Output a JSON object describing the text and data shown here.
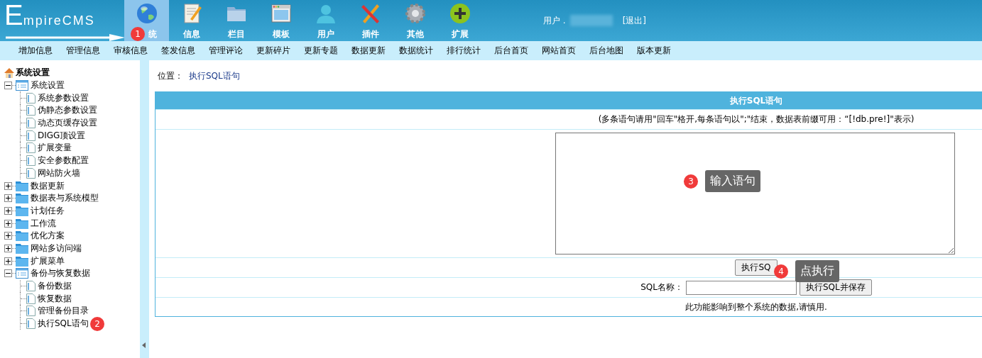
{
  "header": {
    "logo": {
      "initial": "E",
      "rest": "mpireCMS"
    },
    "nav": [
      {
        "label": "统",
        "kind": "globe",
        "selected": true
      },
      {
        "label": "信息",
        "kind": "note",
        "selected": false
      },
      {
        "label": "栏目",
        "kind": "folder",
        "selected": false
      },
      {
        "label": "模板",
        "kind": "window",
        "selected": false
      },
      {
        "label": "用户",
        "kind": "user",
        "selected": false
      },
      {
        "label": "插件",
        "kind": "tools",
        "selected": false
      },
      {
        "label": "其他",
        "kind": "gear",
        "selected": false
      },
      {
        "label": "扩展",
        "kind": "plus",
        "selected": false
      }
    ],
    "user_label": "用户 .",
    "logout": "[退出]"
  },
  "menu": [
    "增加信息",
    "管理信息",
    "审核信息",
    "签发信息",
    "管理评论",
    "更新碎片",
    "更新专题",
    "数据更新",
    "数据统计",
    "排行统计",
    "后台首页",
    "网站首页",
    "后台地图",
    "版本更新"
  ],
  "sidebar": {
    "title": "系统设置",
    "tree": [
      {
        "label": "系统设置",
        "expanded": true,
        "children": [
          {
            "label": "系统参数设置"
          },
          {
            "label": "伪静态参数设置"
          },
          {
            "label": "动态页缓存设置"
          },
          {
            "label": "DIGG顶设置"
          },
          {
            "label": "扩展变量"
          },
          {
            "label": "安全参数配置"
          },
          {
            "label": "网站防火墙"
          }
        ]
      },
      {
        "label": "数据更新",
        "expanded": false
      },
      {
        "label": "数据表与系统模型",
        "expanded": false
      },
      {
        "label": "计划任务",
        "expanded": false
      },
      {
        "label": "工作流",
        "expanded": false
      },
      {
        "label": "优化方案",
        "expanded": false
      },
      {
        "label": "网站多访问端",
        "expanded": false
      },
      {
        "label": "扩展菜单",
        "expanded": false
      },
      {
        "label": "备份与恢复数据",
        "expanded": true,
        "children": [
          {
            "label": "备份数据"
          },
          {
            "label": "恢复数据"
          },
          {
            "label": "管理备份目录"
          },
          {
            "label": "执行SQL语句"
          }
        ]
      }
    ]
  },
  "breadcrumb": {
    "label": "位置：",
    "link": "执行SQL语句"
  },
  "form": {
    "title": "执行SQL语句",
    "note": "(多条语句请用\"回车\"格开,每条语句以\";\"结束，数据表前缀可用：“[!db.pre!]\"表示)",
    "execute_button": "执行SQ",
    "name_label": "SQL名称：",
    "save_button": "执行SQL并保存",
    "warning": "此功能影响到整个系统的数据,请慎用."
  },
  "annotations": [
    {
      "number": "1"
    },
    {
      "number": "2"
    },
    {
      "number": "3",
      "text": "输入语句"
    },
    {
      "number": "4",
      "text": "点执行"
    }
  ]
}
